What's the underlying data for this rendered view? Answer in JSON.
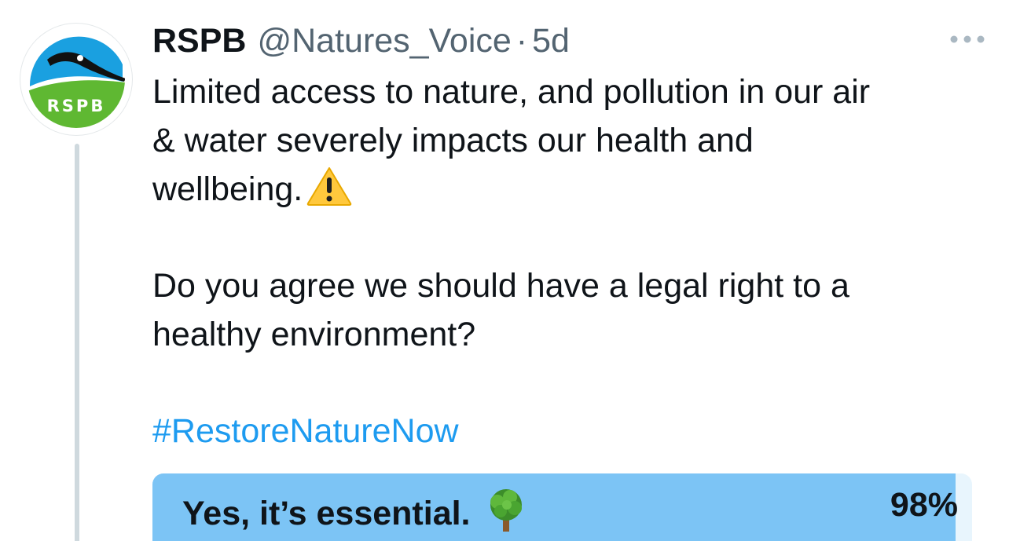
{
  "tweet": {
    "author_name": "RSPB",
    "author_handle": "@Natures_Voice",
    "separator": "·",
    "time_ago": "5d",
    "avatar_text": "RSPB",
    "more_icon": "more-horizontal-icon",
    "paragraph_1_line_1": "Limited access to nature, and pollution in our air",
    "paragraph_1_line_2": "& water severely impacts our health and",
    "paragraph_1_line_3": "wellbeing.",
    "warning_icon": "warning-icon",
    "paragraph_2_line_1": "Do you agree we should have a legal right to a",
    "paragraph_2_line_2": "healthy environment?",
    "hashtag": "#RestoreNatureNow"
  },
  "poll": {
    "options": [
      {
        "label": "Yes, it’s essential.",
        "icon": "tree-icon",
        "percent_text": "98%",
        "percent": 98
      }
    ]
  },
  "colors": {
    "accent": "#1d9bf0",
    "poll_fill": "#7cc4f5",
    "secondary_text": "#536471",
    "thread_line": "#cfd9de",
    "rspb_green": "#5fb832",
    "rspb_blue": "#1aa0e0"
  }
}
